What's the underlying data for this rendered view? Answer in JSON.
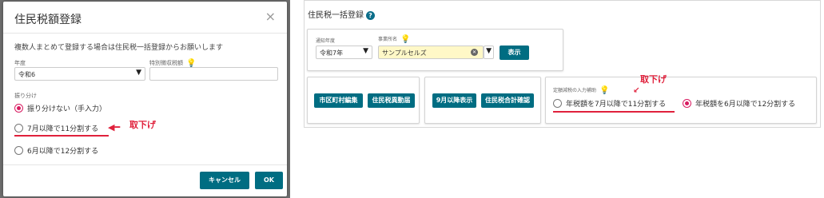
{
  "modal": {
    "title": "住民税額登録",
    "close_icon": "×",
    "note": "複数人まとめて登録する場合は住民税一括登録からお願いします",
    "year_label": "年度",
    "year_value": "令和6",
    "special_label": "特別徴収税額",
    "dist_label": "振り分け",
    "options": [
      "振り分けない（手入力）",
      "7月以降で11分割する",
      "6月以降で12分割する"
    ],
    "selected_index": 0,
    "cancel": "キャンセル",
    "ok": "OK",
    "annotation": "取下げ"
  },
  "page": {
    "title": "住民税一括登録",
    "help": "?",
    "notice_year_label": "通知年度",
    "notice_year_value": "令和7年",
    "office_label": "事業所名",
    "office_value": "サンプルセルズ",
    "display_button": "表示",
    "buttons_a": [
      "市区町村編集",
      "住民税異動届"
    ],
    "buttons_b": [
      "9月以降表示",
      "住民税合計確認"
    ],
    "fixed_label": "定額減税の入力補助",
    "option_11": "年税額を7月以降で11分割する",
    "option_12": "年税額を6月以降で12分割する",
    "selected": "option_12",
    "annotation": "取下げ"
  },
  "colors": {
    "accent": "#006d82",
    "radio": "#d81b60",
    "annotation": "#e0213c",
    "highlight": "#fff8c7"
  }
}
